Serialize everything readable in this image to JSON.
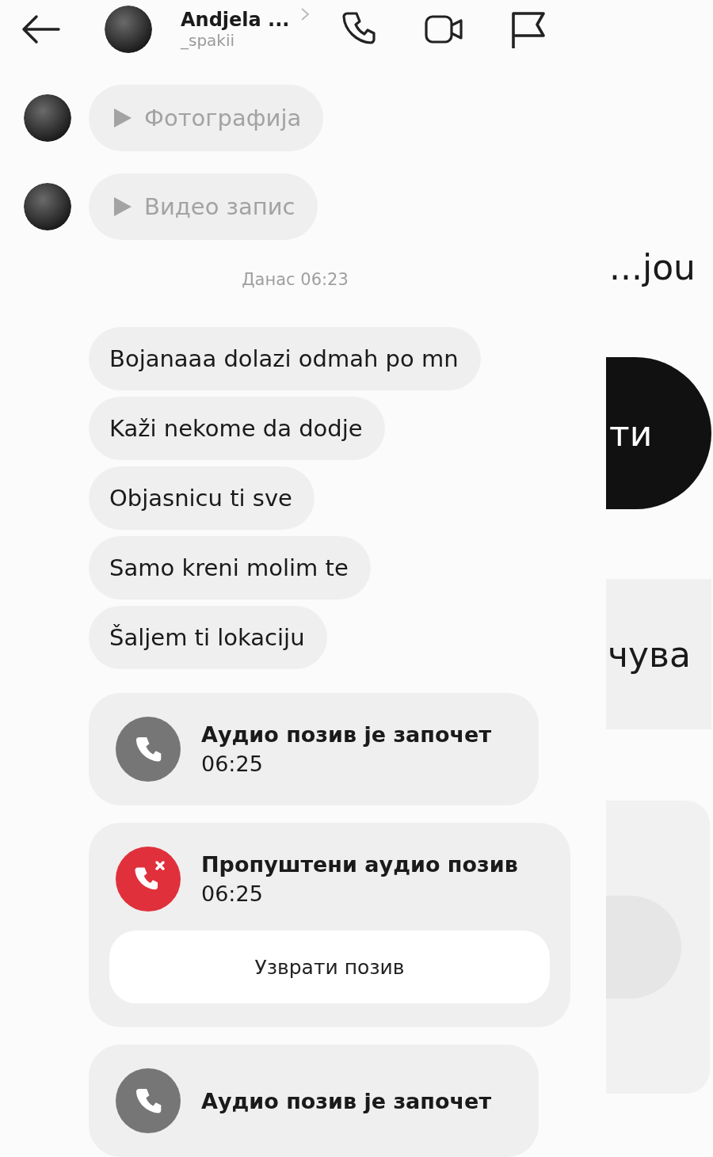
{
  "header": {
    "name": "Andjela ...",
    "username": "_spakii"
  },
  "messages": [
    {
      "kind": "media",
      "text": "Фотографија"
    },
    {
      "kind": "media",
      "text": "Видео запис"
    },
    {
      "kind": "timestamp",
      "text": "Данас 06:23"
    },
    {
      "kind": "text",
      "text": "Bojanaaa dolazi odmah po mn"
    },
    {
      "kind": "text",
      "text": "Kaži nekome da dodje"
    },
    {
      "kind": "text",
      "text": "Objasnicu ti sve"
    },
    {
      "kind": "text",
      "text": "Samo kreni molim te"
    },
    {
      "kind": "text",
      "text": "Šaljem ti lokaciju"
    },
    {
      "kind": "call",
      "missed": false,
      "title": "Аудио позив је започет",
      "time": "06:25"
    },
    {
      "kind": "call",
      "missed": true,
      "title": "Пропуштени аудио позив",
      "time": "06:25",
      "action": "Узврати позив"
    },
    {
      "kind": "call",
      "missed": false,
      "title": "Аудио позив је започет"
    }
  ],
  "background_screen": {
    "heading": "...jou",
    "button": "ти",
    "field": "чува"
  }
}
